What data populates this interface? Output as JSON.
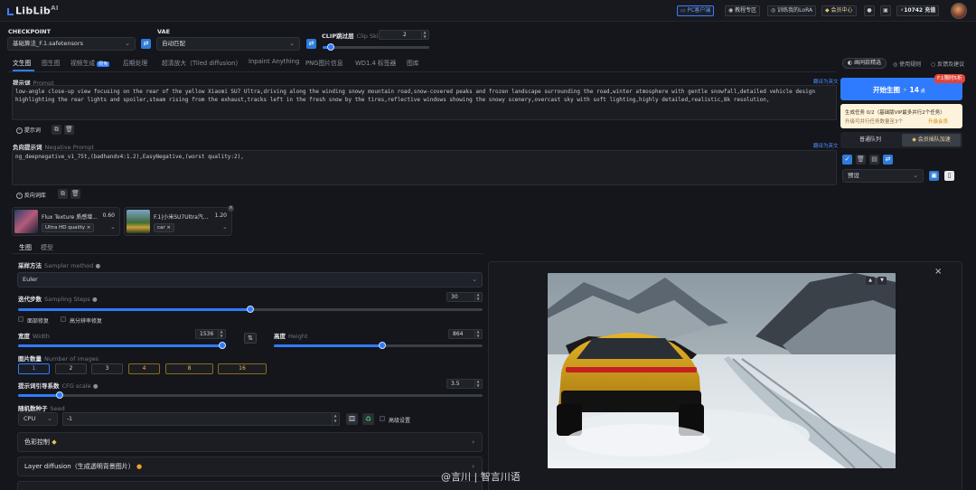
{
  "app": {
    "logo": "LibLib",
    "logo_suffix": "AI"
  },
  "topbar": {
    "pc_client": "PC客户端",
    "tutorial": "教程专区",
    "train_lora": "训练我的LoRA",
    "member": "会员中心",
    "credits": "10742",
    "recharge": "充值"
  },
  "checkpoint": {
    "label": "CHECKPOINT",
    "value": "基础算法_F.1.safetensors"
  },
  "vae": {
    "label": "VAE",
    "value": "自动匹配"
  },
  "clip": {
    "label": "CLIP跳过层",
    "sublabel": "Clip Skip",
    "value": "2",
    "fraction": 0.08
  },
  "tabs": [
    "文生图",
    "图生图",
    "视频生成",
    "后期处理",
    "超清放大（Tiled diffusion）",
    "Inpaint Anything",
    "PNG图片信息",
    "WD1.4 标签器",
    "图库"
  ],
  "tab_badge": "限免",
  "prompt": {
    "label": "提示词",
    "sublabel": "Prompt",
    "translate": "翻译为英文",
    "text": "low-angle close-up view focusing on the rear of the yellow Xiaomi SU7 Ultra,driving along the winding snowy mountain road,snow-covered peaks and frozen landscape surrounding the road,winter atmosphere with gentle snowfall,detailed vehicle design highlighting the rear lights and spoiler,steam rising from the exhaust,tracks left in the fresh snow by the tires,reflective windows showing the snowy scenery,overcast sky with soft lighting,highly detailed,realistic,8k resolution,",
    "library": "提示词"
  },
  "negative": {
    "label": "负向提示词",
    "sublabel": "Negative Prompt",
    "translate": "翻译为英文",
    "text": "ng_deepnegative_v1_75t,(badhandv4:1.2),EasyNegative,(worst quality:2),",
    "library": "反向词库"
  },
  "loras": [
    {
      "name": "Flux Texture 质感增...",
      "weight": "0.60",
      "tag": "Ultra HD quality"
    },
    {
      "name": "F.1|小米SU7Ultra汽...",
      "weight": "1.20",
      "tag": "car"
    }
  ],
  "subtabs": [
    "生图",
    "模型"
  ],
  "sampler": {
    "label": "采样方法",
    "sublabel": "Sampler method",
    "value": "Euler"
  },
  "steps": {
    "label": "迭代步数",
    "sublabel": "Sampling Steps",
    "value": "30",
    "fraction": 0.5
  },
  "options": {
    "face_fix": "面部修复",
    "hires_fix": "高分辨率修复"
  },
  "width": {
    "label": "宽度",
    "sublabel": "Width",
    "value": "1536",
    "fraction": 1.0
  },
  "height": {
    "label": "高度",
    "sublabel": "Height",
    "value": "864",
    "fraction": 0.52
  },
  "batch": {
    "label": "图片数量",
    "sublabel": "Number of images",
    "values": [
      "1",
      "2",
      "3",
      "4",
      "8",
      "16"
    ]
  },
  "cfg": {
    "label": "提示词引导系数",
    "sublabel": "CFG scale",
    "value": "3.5",
    "fraction": 0.09
  },
  "seed": {
    "label": "随机数种子",
    "sublabel": "Seed",
    "device": "CPU",
    "value": "-1",
    "advanced": "高级设置"
  },
  "accordions": {
    "color": "色彩控制",
    "layer": "Layer diffusion（生成透明背景图片）"
  },
  "right": {
    "chip_label": "画同款精选",
    "rules": "使用规则",
    "feedback": "反馈及建议",
    "generate": "开始生图",
    "cost": "14",
    "badge": "F.1限时5折",
    "task_line1": "生成任务 0/2（基础版VIP最多并行2个任务）",
    "task_line2": "升级可并行任务数量至3个",
    "upgrade": "升级会员",
    "queue_normal": "普通队列",
    "queue_vip": "会员插队加速",
    "preset": "预设"
  },
  "watermark": "@言川 | 智言川语",
  "colors": {
    "accent": "#2f7bff",
    "gold": "#e8c15a",
    "badge": "#e0453a"
  }
}
